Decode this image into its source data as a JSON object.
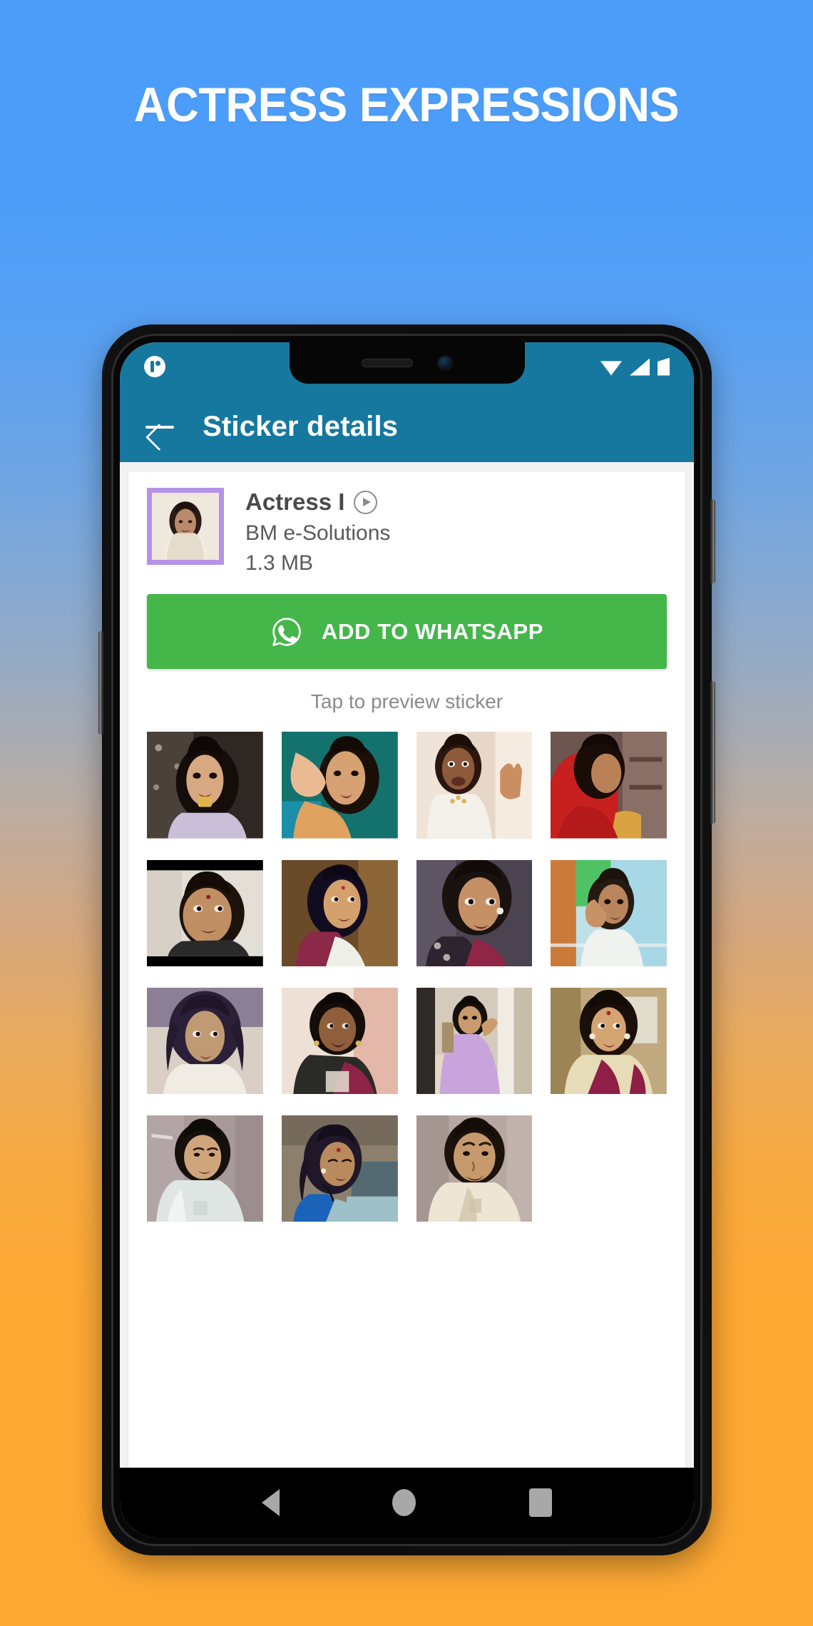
{
  "banner": {
    "headline": "ACTRESS EXPRESSIONS",
    "background_top_color": "#4c9df9",
    "background_bottom_color": "#fda833"
  },
  "phone": {
    "statusbar": {
      "notification_icon": "app-logo-icon",
      "wifi_icon": "wifi-icon",
      "signal_icon": "cellular-signal-icon",
      "battery_icon": "battery-icon"
    },
    "appbar": {
      "back_icon": "back-arrow-icon",
      "title": "Sticker details",
      "background_color": "#16789f"
    },
    "navbar": {
      "back": "nav-back",
      "home": "nav-home",
      "recents": "nav-recents"
    }
  },
  "pack": {
    "title": "Actress I",
    "play_icon": "play-circle-icon",
    "publisher": "BM e-Solutions",
    "size": "1.3 MB",
    "thumb_border_color": "#b592e8"
  },
  "add_button": {
    "label": "ADD TO WHATSAPP",
    "icon": "whatsapp-icon",
    "color": "#44b64a"
  },
  "preview_hint": "Tap to preview sticker",
  "stickers": [
    {
      "id": 1,
      "alt": "woman eating snack"
    },
    {
      "id": 2,
      "alt": "woman hand near face"
    },
    {
      "id": 3,
      "alt": "woman in white raising hand"
    },
    {
      "id": 4,
      "alt": "woman in red dress"
    },
    {
      "id": 5,
      "alt": "smiling woman letterbox"
    },
    {
      "id": 6,
      "alt": "woman in saree looking aside"
    },
    {
      "id": 7,
      "alt": "woman close-up serious"
    },
    {
      "id": 8,
      "alt": "woman at window waving"
    },
    {
      "id": 9,
      "alt": "young woman curly hair"
    },
    {
      "id": 10,
      "alt": "older woman in dark saree"
    },
    {
      "id": 11,
      "alt": "woman in lavender kurta"
    },
    {
      "id": 12,
      "alt": "woman in cream saree smiling"
    },
    {
      "id": 13,
      "alt": "elderly woman in white saree"
    },
    {
      "id": 14,
      "alt": "woman looking down blue top"
    },
    {
      "id": 15,
      "alt": "elderly woman frowning"
    }
  ]
}
